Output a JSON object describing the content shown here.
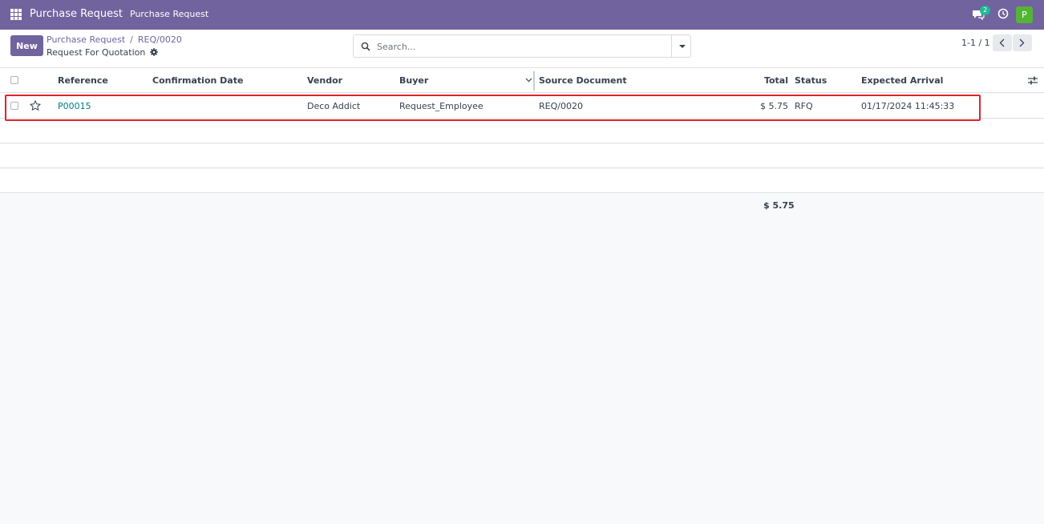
{
  "navbar": {
    "app_title": "Purchase Request",
    "menu_item": "Purchase Request",
    "chat_count": "2",
    "avatar_letter": "P",
    "colors": {
      "navbar": "#71639e",
      "avatar": "#54b435",
      "badge": "#21b799"
    }
  },
  "control": {
    "new_label": "New",
    "breadcrumb": {
      "root": "Purchase Request",
      "separator": "/",
      "current": "REQ/0020"
    },
    "subtitle": "Request For Quotation",
    "search": {
      "placeholder": "Search..."
    },
    "pager": "1-1 / 1"
  },
  "table": {
    "columns": {
      "reference": "Reference",
      "confirmation_date": "Confirmation Date",
      "vendor": "Vendor",
      "buyer": "Buyer",
      "source_document": "Source Document",
      "total": "Total",
      "status": "Status",
      "expected_arrival": "Expected Arrival"
    },
    "rows": [
      {
        "reference": "P00015",
        "confirmation_date": "",
        "vendor": "Deco Addict",
        "buyer": "Request_Employee",
        "source_document": "REQ/0020",
        "total": "$ 5.75",
        "status": "RFQ",
        "expected_arrival": "01/17/2024 11:45:33"
      }
    ],
    "footer_total": "$ 5.75"
  }
}
